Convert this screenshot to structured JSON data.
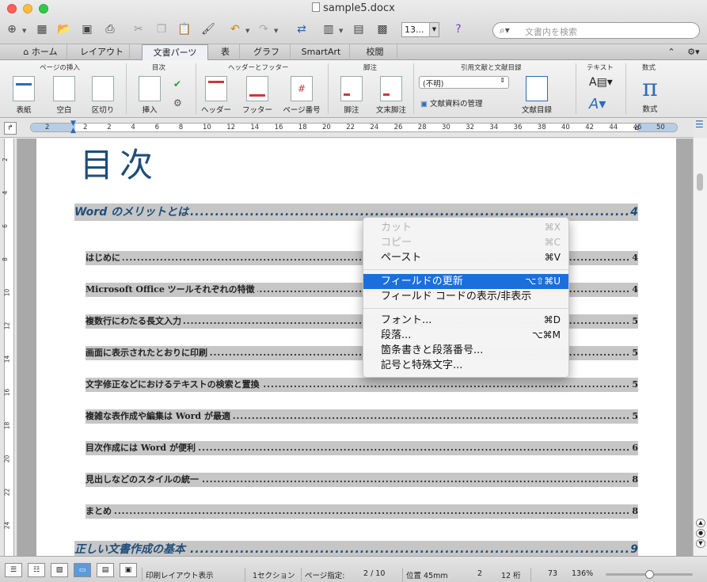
{
  "window": {
    "title": "sample5.docx"
  },
  "toolbar": {
    "zoom_value": "13...",
    "search_placeholder": "文書内を検索"
  },
  "tabs": [
    {
      "label": "ホーム"
    },
    {
      "label": "レイアウト"
    },
    {
      "label": "文書パーツ",
      "active": true
    },
    {
      "label": "表"
    },
    {
      "label": "グラフ"
    },
    {
      "label": "SmartArt"
    },
    {
      "label": "校閲"
    }
  ],
  "ribbon": {
    "groups": {
      "page_insert": "ページの挿入",
      "toc": "目次",
      "header_footer": "ヘッダーとフッター",
      "footnote": "脚注",
      "citation": "引用文献と文献目録",
      "text": "テキスト",
      "equation": "数式"
    },
    "buttons": {
      "cover": "表紙",
      "blank": "空白",
      "break": "区切り",
      "insert": "挿入",
      "header": "ヘッダー",
      "footer": "フッター",
      "page_number": "ページ番号",
      "footnote": "脚注",
      "endnote": "文末脚注",
      "bibliography": "文献目録",
      "equation": "数式"
    },
    "bib_style": "(不明)",
    "bib_manager": "文献資料の管理"
  },
  "ruler": {
    "numbers": [
      "2",
      "2",
      "2",
      "4",
      "6",
      "8",
      "10",
      "12",
      "14",
      "16",
      "18",
      "20",
      "22",
      "24",
      "26",
      "28",
      "30",
      "32",
      "34",
      "36",
      "38",
      "40",
      "42",
      "44",
      "46",
      "50"
    ]
  },
  "vruler": {
    "numbers": [
      "2",
      "4",
      "6",
      "8",
      "10",
      "12",
      "14",
      "16",
      "18",
      "20",
      "22",
      "24"
    ]
  },
  "document": {
    "toc_title": "目次",
    "entries": [
      {
        "level": 1,
        "text": "Word のメリットとは",
        "page": "4"
      },
      {
        "level": 2,
        "text": "はじめに",
        "page": "4"
      },
      {
        "level": 2,
        "text": "Microsoft Office ツールそれぞれの特徴",
        "page": "4"
      },
      {
        "level": 2,
        "text": "複数行にわたる長文入力",
        "page": "5"
      },
      {
        "level": 2,
        "text": "画面に表示されたとおりに印刷",
        "page": "5"
      },
      {
        "level": 2,
        "text": "文字修正などにおけるテキストの検索と置換",
        "page": "5"
      },
      {
        "level": 2,
        "text": "複雑な表作成や編集は Word が最適",
        "page": "5"
      },
      {
        "level": 2,
        "text": "目次作成には Word が便利",
        "page": "6"
      },
      {
        "level": 2,
        "text": "見出しなどのスタイルの統一",
        "page": "8"
      },
      {
        "level": 2,
        "text": "まとめ",
        "page": "8"
      },
      {
        "level": 1,
        "text": "正しい文書作成の基本",
        "page": "9"
      }
    ]
  },
  "context_menu": {
    "items": [
      {
        "label": "カット",
        "shortcut": "⌘X",
        "disabled": true
      },
      {
        "label": "コピー",
        "shortcut": "⌘C",
        "disabled": true
      },
      {
        "label": "ペースト",
        "shortcut": "⌘V"
      },
      {
        "separator": true
      },
      {
        "label": "フィールドの更新",
        "shortcut": "⌥⇧⌘U",
        "highlighted": true
      },
      {
        "label": "フィールド コードの表示/非表示",
        "shortcut": ""
      },
      {
        "separator": true
      },
      {
        "label": "フォント...",
        "shortcut": "⌘D"
      },
      {
        "label": "段落...",
        "shortcut": "⌥⌘M"
      },
      {
        "label": "箇条書きと段落番号...",
        "shortcut": ""
      },
      {
        "label": "記号と特殊文字...",
        "shortcut": ""
      }
    ]
  },
  "status": {
    "view": "印刷レイアウト表示",
    "section": "1セクション",
    "page_label": "ページ指定:",
    "page": "2 / 10",
    "position": "位置 45mm",
    "line": "2",
    "column": "12 桁",
    "words": "73",
    "zoom": "136%"
  },
  "colors": {
    "accent": "#1c6fdb",
    "heading": "#1f4e79",
    "toc_shade": "#c6c6c6"
  }
}
